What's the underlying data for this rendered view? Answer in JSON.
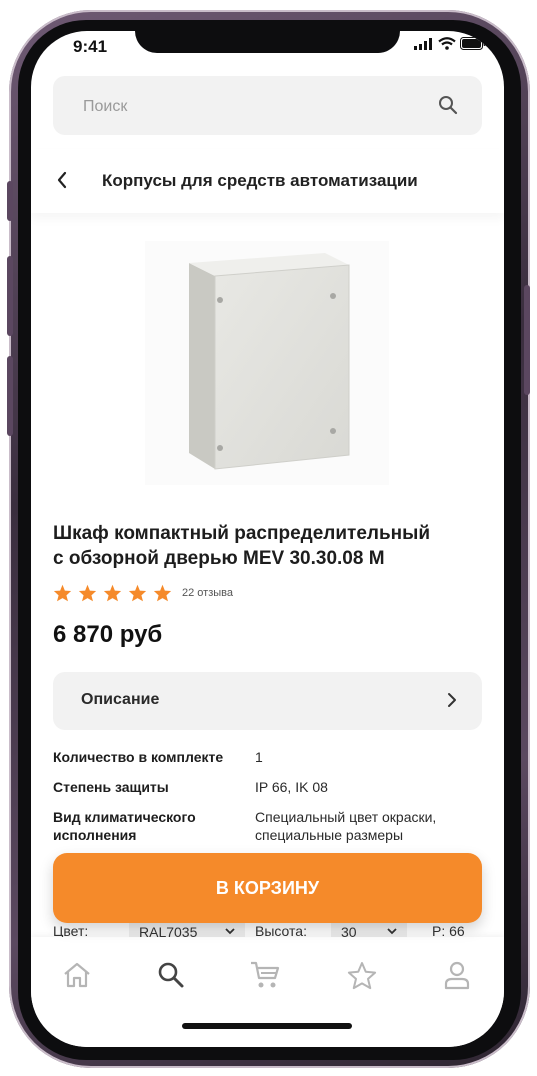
{
  "status_bar": {
    "time": "9:41"
  },
  "search": {
    "placeholder": "Поиск"
  },
  "header": {
    "title": "Корпусы для средств автоматизации"
  },
  "product": {
    "title_line1": "Шкаф компактный распределительный",
    "title_line2": "с обзорной дверью MEV 30.30.08 M",
    "rating_stars": 5,
    "reviews": "22 отзыва",
    "price": "6 870 руб"
  },
  "description": {
    "label": "Описание"
  },
  "specs": [
    {
      "key": "Количество в комплекте",
      "value": "1"
    },
    {
      "key": "Степень защиты",
      "value": "IP 66, IK 08"
    },
    {
      "key_line1": "Вид климатического",
      "key_line2": "исполнения",
      "value_line1": "Специальный цвет окраски,",
      "value_line2": "специальные размеры"
    }
  ],
  "options_row": {
    "color_label": "Цвет:",
    "color_value": "RAL7035",
    "height_label": "Высота:",
    "height_value": "30",
    "extra": "P: 66"
  },
  "cart_button": {
    "label": "В КОРЗИНУ"
  },
  "tabbar": [
    "home-icon",
    "search-icon",
    "cart-icon",
    "favorites-star-icon",
    "profile-icon"
  ],
  "colors": {
    "accent": "#f58a2a",
    "star": "#f58a2a",
    "surface": "#f2f2f2",
    "inactive_icon": "#b5b5b5",
    "active_icon": "#444444"
  }
}
